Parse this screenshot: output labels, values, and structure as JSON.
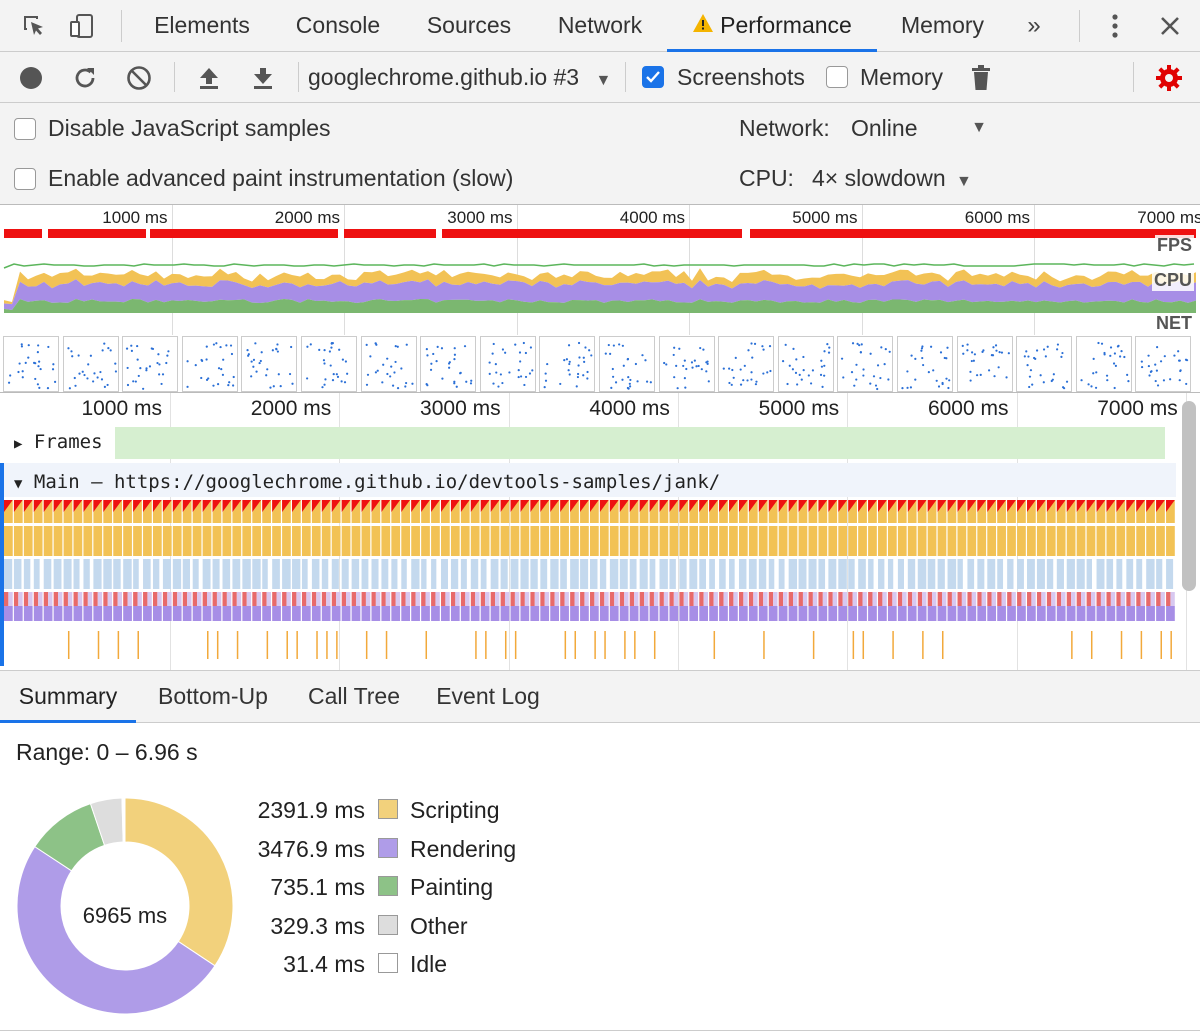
{
  "tabs": [
    "Elements",
    "Console",
    "Sources",
    "Network",
    "Performance",
    "Memory"
  ],
  "active_tab": "Performance",
  "toolbar": {
    "profile_select": "googlechrome.github.io #3",
    "screenshots_label": "Screenshots",
    "memory_label": "Memory"
  },
  "settings": {
    "disable_js_samples": "Disable JavaScript samples",
    "advanced_paint": "Enable advanced paint instrumentation (slow)",
    "network_label": "Network:",
    "network_value": "Online",
    "cpu_label": "CPU:",
    "cpu_value": "4× slowdown"
  },
  "overview": {
    "ticks": [
      "1000 ms",
      "2000 ms",
      "3000 ms",
      "4000 ms",
      "5000 ms",
      "6000 ms",
      "7000 ms"
    ],
    "tracks": [
      "FPS",
      "CPU",
      "NET"
    ]
  },
  "flame": {
    "ticks": [
      "1000 ms",
      "2000 ms",
      "3000 ms",
      "4000 ms",
      "5000 ms",
      "6000 ms",
      "7000 ms"
    ],
    "frames_label": "Frames",
    "main_label": "Main — https://googlechrome.github.io/devtools-samples/jank/"
  },
  "bottom_tabs": [
    "Summary",
    "Bottom-Up",
    "Call Tree",
    "Event Log"
  ],
  "summary": {
    "range": "Range: 0 – 6.96 s",
    "total": "6965 ms",
    "items": [
      {
        "value": "2391.9 ms",
        "name": "Scripting",
        "ms": 2391.9,
        "color": "#f2d17c"
      },
      {
        "value": "3476.9 ms",
        "name": "Rendering",
        "ms": 3476.9,
        "color": "#af9ce8"
      },
      {
        "value": "735.1 ms",
        "name": "Painting",
        "ms": 735.1,
        "color": "#8dc287"
      },
      {
        "value": "329.3 ms",
        "name": "Other",
        "ms": 329.3,
        "color": "#dddddd"
      },
      {
        "value": "31.4 ms",
        "name": "Idle",
        "ms": 31.4,
        "color": "#ffffff"
      }
    ]
  },
  "colors": {
    "accent": "#1a73e8",
    "settings_gear": "#e00000",
    "warning": "#f4b400",
    "long_frame": "#ee1111",
    "scripting": "#f2c255",
    "rendering": "#a78ee6",
    "painting": "#7bb770",
    "frames": "#d6efd0",
    "task_blue": "#c4d9ee"
  }
}
